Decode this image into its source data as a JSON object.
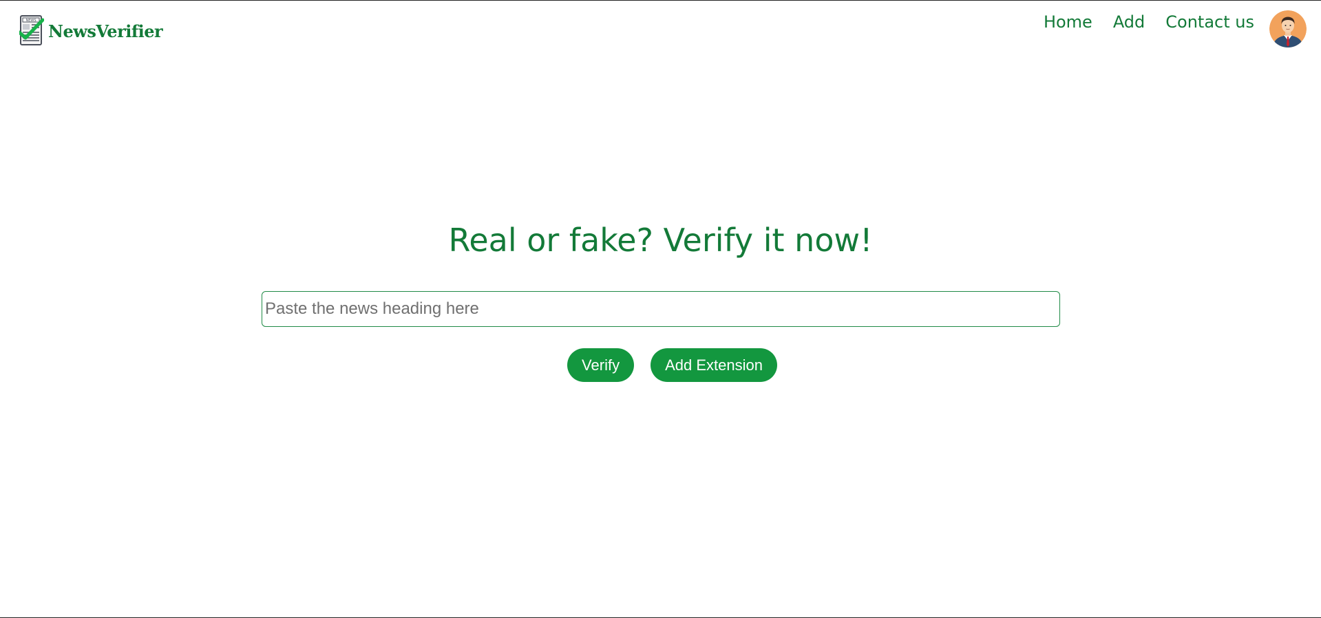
{
  "header": {
    "brand": "NewsVerifier",
    "logo_icon": "newspaper-check-icon",
    "nav": [
      {
        "label": "Home"
      },
      {
        "label": "Add"
      },
      {
        "label": "Contact us"
      }
    ],
    "avatar_icon": "user-avatar-icon"
  },
  "main": {
    "headline": "Real or fake? Verify it now!",
    "search_placeholder": "Paste the news heading here",
    "search_value": "",
    "verify_label": "Verify",
    "extension_label": "Add Extension"
  },
  "colors": {
    "brand_green": "#137a38",
    "button_green": "#13973f",
    "border_green": "#1f8a45"
  }
}
